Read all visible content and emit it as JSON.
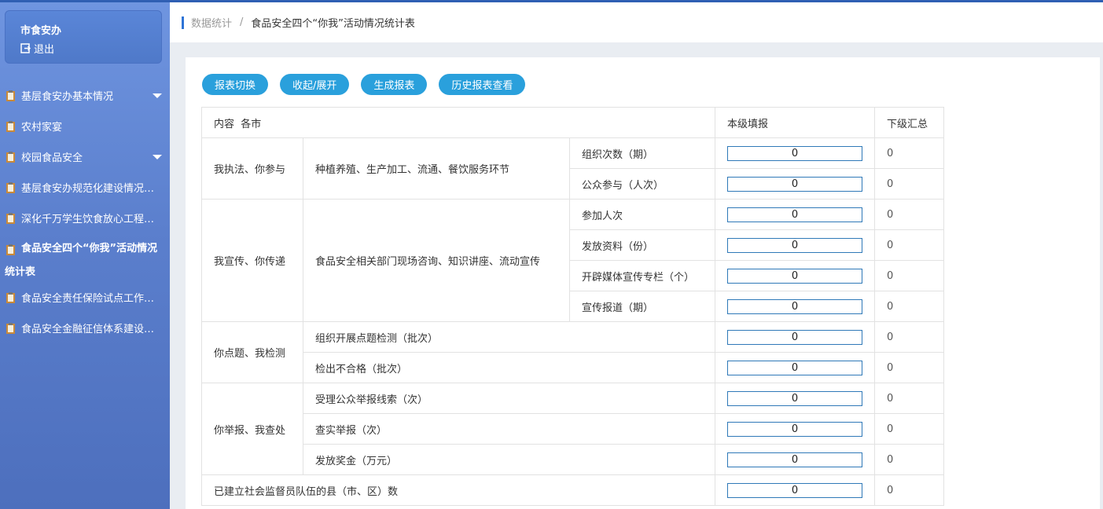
{
  "sidebar": {
    "user_name": "市食安办",
    "logout_label": "退出",
    "items": [
      {
        "label": "基层食安办基本情况",
        "expandable": true
      },
      {
        "label": "农村家宴",
        "expandable": false
      },
      {
        "label": "校园食品安全",
        "expandable": true
      },
      {
        "label": "基层食安办规范化建设情况统计表",
        "expandable": false
      },
      {
        "label": "深化千万学生饮食放心工程统计表",
        "expandable": false
      },
      {
        "label": "食品安全四个“你我”活动情况统计表",
        "expandable": false,
        "active": true
      },
      {
        "label": "食品安全责任保险试点工作统计表",
        "expandable": false
      },
      {
        "label": "食品安全金融征信体系建设统计表",
        "expandable": false
      }
    ]
  },
  "breadcrumb": {
    "parent": "数据统计",
    "separator": "/",
    "current": "食品安全四个“你我”活动情况统计表"
  },
  "toolbar": {
    "switch_label": "报表切换",
    "collapse_label": "收起/展开",
    "generate_label": "生成报表",
    "history_label": "历史报表查看"
  },
  "table": {
    "header_content": "内容  各市",
    "header_local": "本级填报",
    "header_sub": "下级汇总",
    "groups": {
      "g1": "我执法、你参与",
      "g1_desc": "种植养殖、生产加工、流通、餐饮服务环节",
      "g2": "我宣传、你传递",
      "g2_desc": "食品安全相关部门现场咨询、知识讲座、流动宣传",
      "g3": "你点题、我检测",
      "g4": "你举报、我查处"
    },
    "rows": [
      {
        "label": "组织次数（期）",
        "value": "0",
        "sub": "0"
      },
      {
        "label": "公众参与（人次）",
        "value": "0",
        "sub": "0"
      },
      {
        "label": "参加人次",
        "value": "0",
        "sub": "0"
      },
      {
        "label": "发放资料（份）",
        "value": "0",
        "sub": "0"
      },
      {
        "label": "开辟媒体宣传专栏（个）",
        "value": "0",
        "sub": "0"
      },
      {
        "label": "宣传报道（期）",
        "value": "0",
        "sub": "0"
      },
      {
        "label": "组织开展点题检测（批次）",
        "value": "0",
        "sub": "0"
      },
      {
        "label": "检出不合格（批次）",
        "value": "0",
        "sub": "0"
      },
      {
        "label": "受理公众举报线索（次）",
        "value": "0",
        "sub": "0"
      },
      {
        "label": "查实举报（次）",
        "value": "0",
        "sub": "0"
      },
      {
        "label": "发放奖金（万元）",
        "value": "0",
        "sub": "0"
      },
      {
        "label": "已建立社会监督员队伍的县（市、区）数",
        "value": "0",
        "sub": "0"
      }
    ]
  },
  "colors": {
    "sidebar_top": "#6f95e0",
    "sidebar_bottom": "#4d6fbd",
    "button": "#2aa0dc",
    "input_border": "#2f79b8",
    "breadcrumb_accent": "#2f74d6"
  }
}
